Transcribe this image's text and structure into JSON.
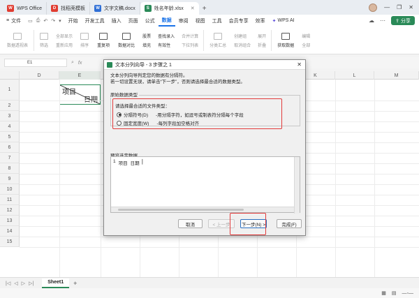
{
  "tabs": [
    {
      "label": "WPS Office",
      "icon": "wps-logo-icon",
      "color": "#e03c31"
    },
    {
      "label": "找稻壳模板",
      "icon": "docer-icon",
      "color": "#e03c31"
    },
    {
      "label": "文字文稿.docx",
      "icon": "writer-doc-icon",
      "color": "#2f6fd6"
    },
    {
      "label": "姓名年龄.xlsx",
      "icon": "spreadsheet-icon",
      "color": "#2a8a58"
    }
  ],
  "menu": {
    "file": "文件",
    "items": [
      "开始",
      "开发工具",
      "插入",
      "页面",
      "公式",
      "数据",
      "审阅",
      "视图",
      "工具",
      "会员专享",
      "效率"
    ],
    "active": "数据",
    "wps_ai": "WPS AI",
    "share": "分享"
  },
  "ribbon": {
    "groups": [
      {
        "label": "数据透视表",
        "dark": false
      },
      {
        "label": "筛选",
        "dark": false
      },
      {
        "label": "全部显示",
        "dark": false,
        "small": true,
        "second": "重新应用"
      },
      {
        "label": "排序",
        "dark": false
      },
      {
        "label": "重复项",
        "dark": true
      },
      {
        "label": "数据对比",
        "dark": true
      },
      {
        "label": "股票",
        "dark": true,
        "small": true,
        "second": "填充"
      },
      {
        "label": "查找录入",
        "dark": true,
        "small": true,
        "second": "有效性"
      },
      {
        "label": "下拉列表",
        "dark": false,
        "small": true,
        "second": "合并计算"
      },
      {
        "label": "分类汇总",
        "dark": false
      },
      {
        "label": "取消组合",
        "dark": false,
        "small": true,
        "second": "创建组"
      },
      {
        "label": "折叠",
        "dark": false,
        "small": true,
        "second": "展开"
      },
      {
        "label": "获取数据",
        "dark": true
      },
      {
        "label": "编辑",
        "dark": false,
        "small": true,
        "second": "全部"
      }
    ]
  },
  "formula": {
    "cell_ref": "E1",
    "fx": "fx"
  },
  "sheet": {
    "columns": [
      "D",
      "E",
      "F",
      "G",
      "H",
      "I",
      "J",
      "K",
      "L",
      "M"
    ],
    "rows": [
      "1",
      "2",
      "3",
      "4",
      "5",
      "6",
      "7",
      "8",
      "9",
      "10",
      "11",
      "12",
      "13",
      "14",
      "15"
    ],
    "e1_top": "项目",
    "e1_bottom": "日期"
  },
  "dialog": {
    "title": "文本分列向导 - 3 步骤之 1",
    "desc_line1": "文本分列向导判定您的数据有分隔符。",
    "desc_line2": "若一切设置无误，请单击“下一步”，否则请选择最合适的数据类型。",
    "group_label": "原始数据类型",
    "prompt": "请选择最合适的文件类型：",
    "option1": "分隔符号(D)",
    "option1_desc": "-用分隔字符，如逗号或制表符分隔每个字段",
    "option2": "固定宽度(W)",
    "option2_desc": "-每列字段加空格对齐",
    "selected": "分隔符号(D)",
    "preview_label": "预览选定数据",
    "preview_line": [
      "1",
      "项目",
      "日期"
    ],
    "btn_cancel": "取消",
    "btn_prev": "< 上一步",
    "btn_next": "下一步(N) >",
    "btn_finish": "完成(F)"
  },
  "sheetbar": {
    "active_sheet": "Sheet1",
    "add": "+"
  },
  "colors": {
    "accent": "#2a8a58",
    "highlight": "#e23b3b",
    "active_menu": "#1a73e8"
  }
}
